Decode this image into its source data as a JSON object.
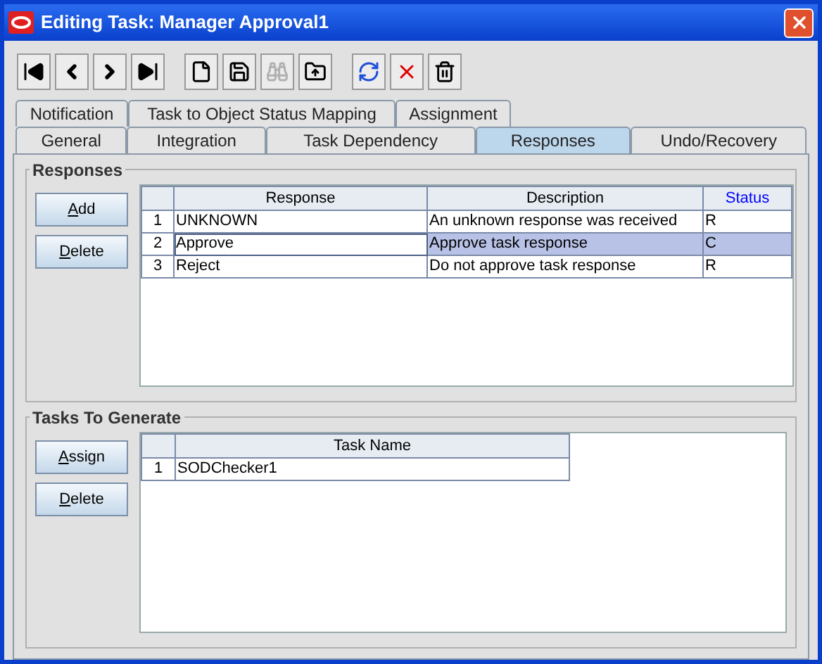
{
  "window": {
    "title": "Editing Task: Manager Approval1"
  },
  "toolbar": [
    {
      "kind": "first",
      "disabled": false
    },
    {
      "kind": "prev",
      "disabled": false
    },
    {
      "kind": "next",
      "disabled": false
    },
    {
      "kind": "last",
      "disabled": false
    },
    {
      "kind": "sep"
    },
    {
      "kind": "new",
      "disabled": false
    },
    {
      "kind": "save",
      "disabled": false
    },
    {
      "kind": "find",
      "disabled": true
    },
    {
      "kind": "attach",
      "disabled": false
    },
    {
      "kind": "sep"
    },
    {
      "kind": "refresh",
      "disabled": false
    },
    {
      "kind": "cancel",
      "disabled": false
    },
    {
      "kind": "trash",
      "disabled": false
    }
  ],
  "tab_rows": [
    [
      {
        "label": "Notification",
        "selected": false
      },
      {
        "label": "Task to Object Status Mapping",
        "selected": false
      },
      {
        "label": "Assignment",
        "selected": false
      }
    ],
    [
      {
        "label": "General",
        "selected": false
      },
      {
        "label": "Integration",
        "selected": false
      },
      {
        "label": "Task Dependency",
        "selected": false
      },
      {
        "label": "Responses",
        "selected": true
      },
      {
        "label": "Undo/Recovery",
        "selected": false
      }
    ]
  ],
  "responses": {
    "title": "Responses",
    "buttons": [
      "Add",
      "Delete"
    ],
    "columns": [
      {
        "label": "Response",
        "selected": false
      },
      {
        "label": "Description",
        "selected": false
      },
      {
        "label": "Status",
        "selected": true
      }
    ],
    "rows": [
      {
        "number": "1",
        "selected": false,
        "cells": [
          {
            "text": "UNKNOWN",
            "focused": false
          },
          {
            "text": "An unknown response was received",
            "focused": false
          },
          {
            "text": "R",
            "focused": false
          }
        ]
      },
      {
        "number": "2",
        "selected": true,
        "cells": [
          {
            "text": "Approve",
            "focused": true
          },
          {
            "text": "Approve task response",
            "focused": false
          },
          {
            "text": "C",
            "focused": false
          }
        ]
      },
      {
        "number": "3",
        "selected": false,
        "cells": [
          {
            "text": "Reject",
            "focused": false
          },
          {
            "text": "Do not approve task response",
            "focused": false
          },
          {
            "text": "R",
            "focused": false
          }
        ]
      }
    ]
  },
  "tasks": {
    "title": "Tasks To Generate",
    "buttons": [
      "Assign",
      "Delete"
    ],
    "columns": [
      {
        "label": "Task Name",
        "selected": false
      }
    ],
    "rows": [
      {
        "number": "1",
        "selected": false,
        "cells": [
          {
            "text": "SODChecker1",
            "focused": false
          }
        ]
      }
    ]
  }
}
